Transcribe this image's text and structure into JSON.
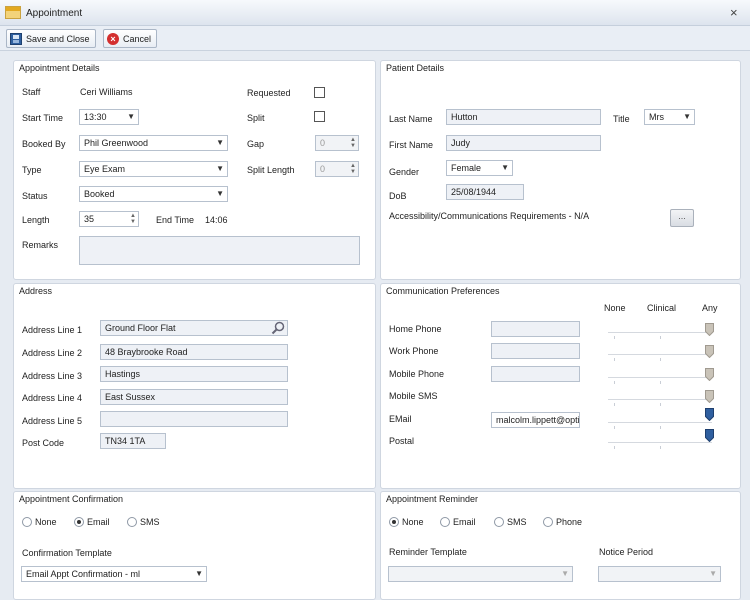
{
  "window": {
    "title": "Appointment",
    "close_glyph": "×"
  },
  "toolbar": {
    "save_label": "Save and Close",
    "cancel_label": "Cancel",
    "cancel_glyph": "×"
  },
  "appointment_details": {
    "title": "Appointment Details",
    "staff_label": "Staff",
    "staff_value": "Ceri Williams",
    "requested_label": "Requested",
    "start_time_label": "Start Time",
    "start_time_value": "13:30",
    "split_label": "Split",
    "booked_by_label": "Booked By",
    "booked_by_value": "Phil Greenwood",
    "gap_label": "Gap",
    "gap_value": "0",
    "type_label": "Type",
    "type_value": "Eye Exam",
    "split_length_label": "Split Length",
    "split_length_value": "0",
    "status_label": "Status",
    "status_value": "Booked",
    "length_label": "Length",
    "length_value": "35",
    "end_time_label": "End Time",
    "end_time_value": "14:06",
    "remarks_label": "Remarks",
    "remarks_value": ""
  },
  "patient_details": {
    "title": "Patient Details",
    "last_name_label": "Last Name",
    "last_name_value": "Hutton",
    "title_label": "Title",
    "title_value": "Mrs",
    "first_name_label": "First Name",
    "first_name_value": "Judy",
    "gender_label": "Gender",
    "gender_value": "Female",
    "dob_label": "DoB",
    "dob_value": "25/08/1944",
    "accessibility_label": "Accessibility/Communications Requirements - N/A",
    "ellipsis_label": "..."
  },
  "address": {
    "title": "Address",
    "lines": [
      {
        "label": "Address Line 1",
        "value": "Ground Floor Flat"
      },
      {
        "label": "Address Line 2",
        "value": "48 Braybrooke Road"
      },
      {
        "label": "Address Line 3",
        "value": "Hastings"
      },
      {
        "label": "Address Line 4",
        "value": "East Sussex"
      },
      {
        "label": "Address Line 5",
        "value": ""
      }
    ],
    "postcode_label": "Post Code",
    "postcode_value": "TN34 1TA"
  },
  "communication": {
    "title": "Communication Preferences",
    "col_none": "None",
    "col_clinical": "Clinical",
    "col_any": "Any",
    "rows": [
      {
        "label": "Home Phone",
        "value": "",
        "level": "any",
        "active": false
      },
      {
        "label": "Work Phone",
        "value": "",
        "level": "any",
        "active": false
      },
      {
        "label": "Mobile Phone",
        "value": "",
        "level": "any",
        "active": false
      },
      {
        "label": "Mobile SMS",
        "value": "",
        "level": "any",
        "active": false
      },
      {
        "label": "EMail",
        "value": "malcolm.lippett@optix",
        "level": "any",
        "active": true
      },
      {
        "label": "Postal",
        "value": "",
        "level": "any",
        "active": true
      }
    ]
  },
  "confirmation": {
    "title": "Appointment Confirmation",
    "opt_none": "None",
    "opt_email": "Email",
    "opt_sms": "SMS",
    "selected": "Email",
    "template_label": "Confirmation Template",
    "template_value": "Email Appt Confirmation - ml"
  },
  "reminder": {
    "title": "Appointment Reminder",
    "opt_none": "None",
    "opt_email": "Email",
    "opt_sms": "SMS",
    "opt_phone": "Phone",
    "selected": "None",
    "template_label": "Reminder Template",
    "template_value": "",
    "notice_label": "Notice Period",
    "notice_value": ""
  },
  "colors": {
    "active_slider": "#2f5f9f",
    "inactive_slider": "#c9c3b8",
    "panel_border": "#cfd6e0"
  },
  "icons": {
    "app": "appointment-book-icon",
    "save": "floppy-disk-icon",
    "cancel": "red-x-icon",
    "search": "magnifier-icon"
  }
}
